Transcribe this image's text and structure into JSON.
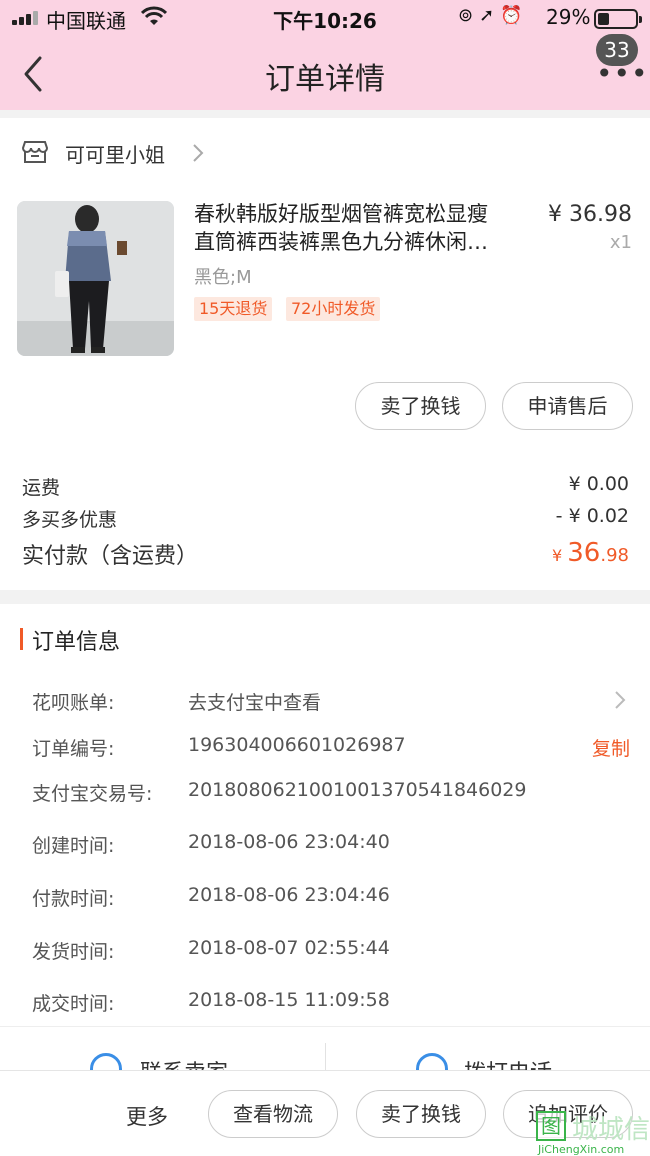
{
  "status_bar": {
    "carrier": "中国联通",
    "time": "下午10:26",
    "battery": "29%"
  },
  "nav": {
    "title": "订单详情",
    "badge": "33"
  },
  "shop": {
    "name": "可可里小姐"
  },
  "product": {
    "title_line1": "春秋韩版好版型烟管裤宽松显瘦",
    "title_line2": "直筒裤西装裤黑色九分裤休闲…",
    "price": "¥ 36.98",
    "qty": "x1",
    "sku": "黑色;M",
    "tags": [
      "15天退货",
      "72小时发货"
    ]
  },
  "item_actions": {
    "resell": "卖了换钱",
    "after_sale": "申请售后"
  },
  "fees": {
    "shipping_label": "运费",
    "shipping_value": "¥ 0.00",
    "discount_label": "多买多优惠",
    "discount_value": "- ¥ 0.02",
    "total_label": "实付款（含运费）",
    "total_currency": "¥ ",
    "total_int": "36",
    "total_dec": ".98"
  },
  "order_info": {
    "title": "订单信息",
    "rows": [
      {
        "key": "花呗账单:",
        "value": "去支付宝中查看"
      },
      {
        "key": "订单编号:",
        "value": "196304006601026987",
        "action": "复制"
      },
      {
        "key": "支付宝交易号:",
        "value": "2018080621001001370541846029"
      },
      {
        "key": "创建时间:",
        "value": "2018-08-06 23:04:40"
      },
      {
        "key": "付款时间:",
        "value": "2018-08-06 23:04:46"
      },
      {
        "key": "发货时间:",
        "value": "2018-08-07 02:55:44"
      },
      {
        "key": "成交时间:",
        "value": "2018-08-15 11:09:58"
      }
    ]
  },
  "contact": {
    "seller": "联系卖家",
    "call": "拨打电话"
  },
  "bottom_bar": {
    "more": "更多",
    "logistics": "查看物流",
    "resell": "卖了换钱",
    "review": "追加评价"
  },
  "watermark": {
    "box": "图",
    "text": "城城信",
    "url": "JiChengXin.com"
  }
}
